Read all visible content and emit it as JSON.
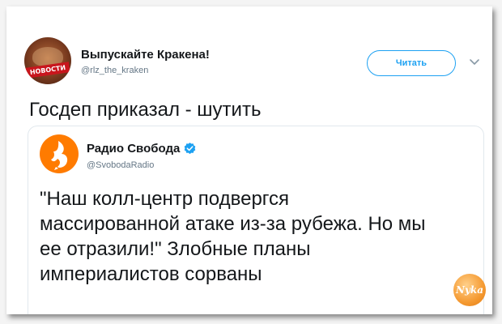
{
  "tweet": {
    "author": {
      "display_name": "Выпускайте Кракена!",
      "handle": "@rlz_the_kraken",
      "avatar_ribbon": "НОВОСТИ"
    },
    "follow_label": "Читать",
    "text": "Госдеп приказал - шутить",
    "quoted": {
      "display_name": "Радио Свобода",
      "handle": "@SvobodaRadio",
      "verified": true,
      "lines": [
        "\"Наш колл-центр подвергся",
        "массированной атаке из-за рубежа. Но мы",
        "ее отразили!\" Злобные планы",
        "империалистов сорваны"
      ]
    }
  },
  "watermark": {
    "text": "Nyka"
  },
  "colors": {
    "accent": "#1da1f2",
    "text": "#14171a",
    "muted": "#657786",
    "radio_logo": "#ff7b00"
  }
}
